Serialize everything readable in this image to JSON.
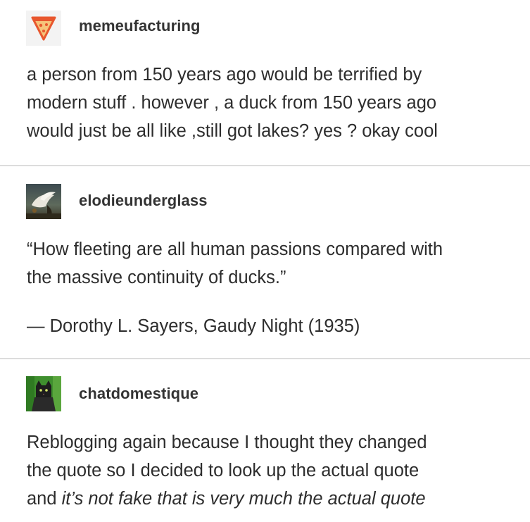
{
  "posts": [
    {
      "username": "memeufacturing",
      "avatar_icon": "pizza-slice-icon",
      "lines": [
        "a person from 150 years ago would be terrified by",
        "modern stuff . however , a duck from 150 years ago",
        "would just be all like ,still got lakes? yes ? okay cool"
      ]
    },
    {
      "username": "elodieunderglass",
      "avatar_icon": "swan-painting-icon",
      "quote_lines": [
        "“How fleeting are all human passions compared with",
        "the massive continuity of ducks.”"
      ],
      "attribution": "— Dorothy L. Sayers, Gaudy Night (1935)"
    },
    {
      "username": "chatdomestique",
      "avatar_icon": "black-cat-icon",
      "lines": [
        "Reblogging again because I thought they changed",
        "the quote so I decided to look up the actual quote"
      ],
      "last_line_prefix": "and ",
      "last_line_italic": "it’s not fake that is very much the actual quote"
    }
  ],
  "colors": {
    "text": "#2d2d2d",
    "username": "#333333",
    "divider": "#dcdcdc",
    "pizza_crust": "#e8572e",
    "pizza_cheese": "#f6c37a"
  }
}
